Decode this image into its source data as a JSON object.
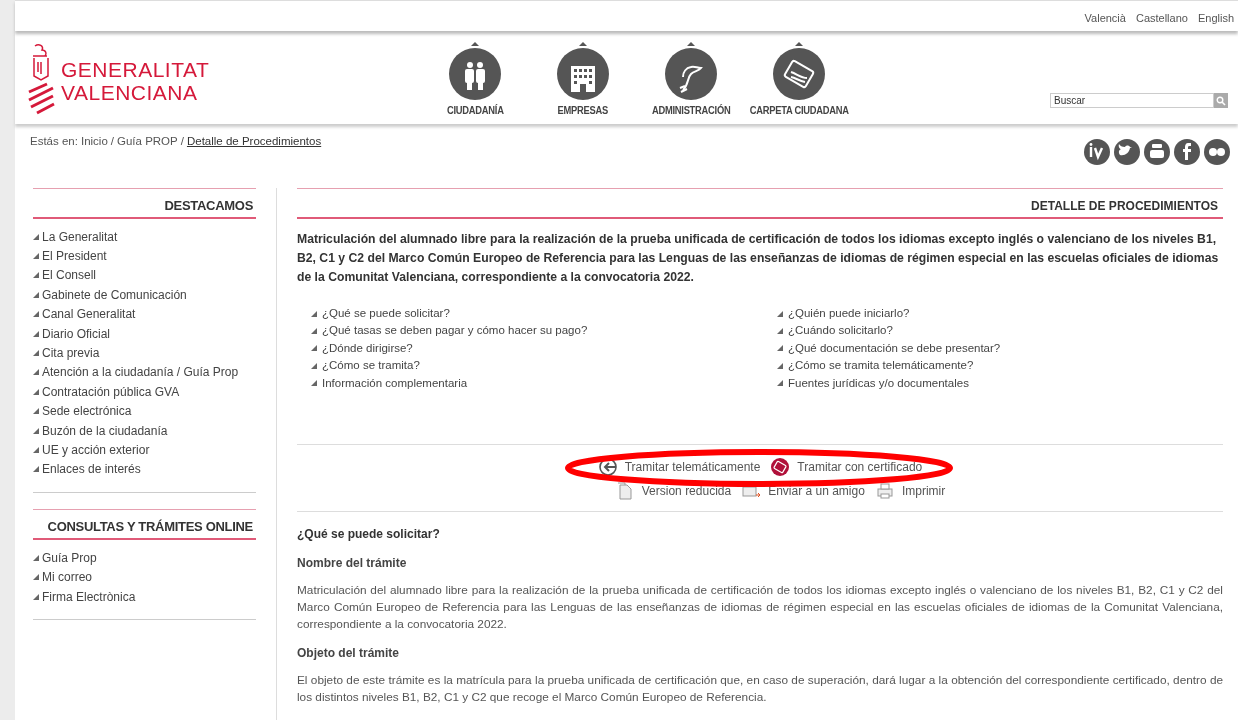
{
  "languages": [
    {
      "label": "Valencià"
    },
    {
      "label": "Castellano"
    },
    {
      "label": "English"
    }
  ],
  "logo": {
    "lines": [
      "GENERALITAT",
      "VALENCIANA"
    ]
  },
  "nav": [
    {
      "label": "CIUDADANÍA",
      "kind": "people"
    },
    {
      "label": "EMPRESAS",
      "kind": "building"
    },
    {
      "label": "ADMINISTRACIÓN",
      "kind": "dragon"
    },
    {
      "label": "CARPETA CIUDADANA",
      "kind": "card"
    }
  ],
  "search": {
    "placeholder": "Buscar"
  },
  "breadcrumb": {
    "prefix": "Estás en:",
    "separator": "/",
    "items": [
      {
        "label": "Inicio",
        "link": false
      },
      {
        "label": "Guía PROP",
        "link": false
      },
      {
        "label": "Detalle de Procedimientos",
        "link": true
      }
    ]
  },
  "sidebar": [
    {
      "title": "DESTACAMOS",
      "items": [
        "La Generalitat",
        "El President",
        "El Consell",
        "Gabinete de Comunicación",
        "Canal Generalitat",
        "Diario Oficial",
        "Cita previa",
        "Atención a la ciudadanía / Guía Prop",
        "Contratación pública GVA",
        "Sede electrónica",
        "Buzón de la ciudadanía",
        "UE y acción exterior",
        "Enlaces de interés"
      ]
    },
    {
      "title": "CONSULTAS Y TRÁMITES ONLINE",
      "items": [
        "Guía Prop",
        "Mi correo",
        "Firma Electrònica"
      ]
    }
  ],
  "main": {
    "heading": "DETALLE DE PROCEDIMIENTOS",
    "title": "Matriculación del alumnado libre para la realización de la prueba unificada de certificación de todos los idiomas excepto inglés o valenciano de los niveles B1, B2, C1 y C2 del Marco Común Europeo de Referencia para las Lenguas de las enseñanzas de idiomas de régimen especial en las escuelas oficiales de idiomas de la Comunitat Valenciana, correspondiente a la convocatoria 2022.",
    "links": [
      "¿Qué se puede solicitar?",
      "¿Quién puede iniciarlo?",
      "¿Qué tasas se deben pagar y cómo hacer su pago?",
      "¿Cuándo solicitarlo?",
      "¿Dónde dirigirse?",
      "¿Qué documentación se debe presentar?",
      "¿Cómo se tramita?",
      "¿Cómo se tramita telemáticamente?",
      "Información complementaria",
      "Fuentes jurídicas y/o documentales"
    ],
    "actions": [
      [
        {
          "label": "Tramitar telemáticamente",
          "kind": "online"
        },
        {
          "label": "Tramitar con certificado",
          "kind": "certificate"
        }
      ],
      [
        {
          "label": "Version reducida",
          "kind": "pages"
        },
        {
          "label": "Enviar a un amigo",
          "kind": "mail"
        },
        {
          "label": "Imprimir",
          "kind": "print"
        }
      ]
    ],
    "content": [
      {
        "kind": "question",
        "text": "¿Qué se puede solicitar?"
      },
      {
        "kind": "subheading",
        "text": "Nombre del trámite"
      },
      {
        "kind": "paragraph",
        "text": "Matriculación del alumnado libre para la realización de la prueba unificada de certificación de todos los idiomas excepto inglés o valenciano de los niveles B1, B2, C1 y C2 del Marco Común Europeo de Referencia para las Lenguas de las enseñanzas de idiomas de régimen especial en las escuelas oficiales de idiomas de la Comunitat Valenciana, correspondiente a la convocatoria 2022."
      },
      {
        "kind": "subheading",
        "text": "Objeto del trámite"
      },
      {
        "kind": "paragraph",
        "text": "El objeto de este trámite es la matrícula para la prueba unificada de certificación que, en caso de superación, dará lugar a la obtención del correspondiente certificado, dentro de los distintos niveles B1, B2, C1 y C2 que recoge el Marco Común Europeo de Referencia."
      }
    ]
  }
}
